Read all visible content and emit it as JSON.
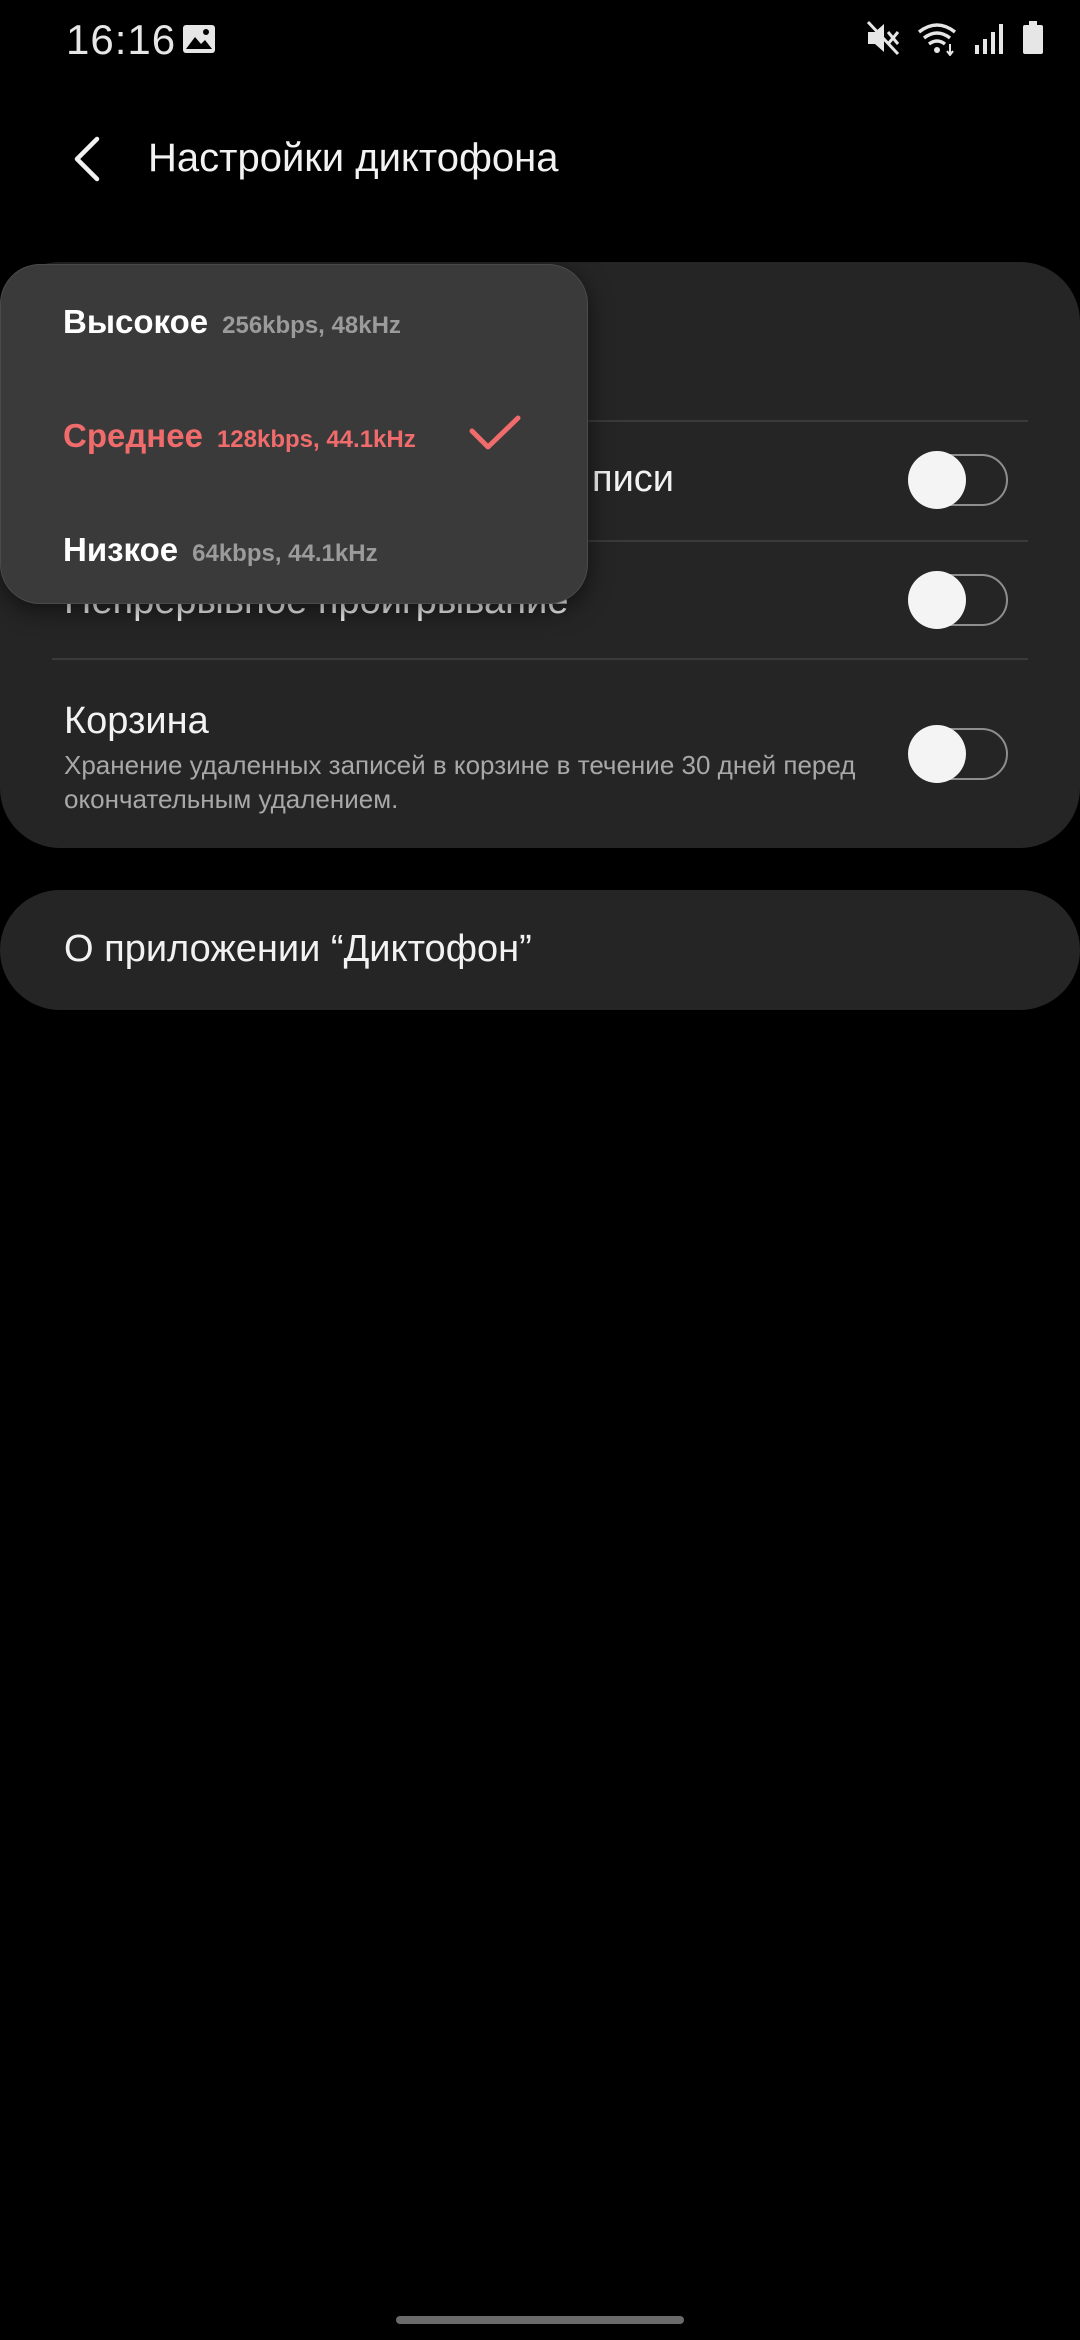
{
  "status_bar": {
    "time": "16:16",
    "icons": [
      "gallery-icon",
      "mute-icon",
      "wifi-icon",
      "signal-icon",
      "battery-icon"
    ]
  },
  "header": {
    "title": "Настройки диктофона",
    "back_icon": "chevron-left-icon"
  },
  "settings": {
    "row1_title_visible": "писи",
    "row2_title_visible": "Непрерывное проигрывание",
    "trash": {
      "title": "Корзина",
      "subtitle": "Хранение удаленных записей в корзине в течение 30 дней перед окончательным удалением."
    }
  },
  "about": {
    "label": "О приложении “Диктофон”"
  },
  "quality_menu": {
    "options": [
      {
        "name": "Высокое",
        "detail": "256kbps, 48kHz",
        "selected": false
      },
      {
        "name": "Среднее",
        "detail": "128kbps, 44.1kHz",
        "selected": true
      },
      {
        "name": "Низкое",
        "detail": "64kbps, 44.1kHz",
        "selected": false
      }
    ]
  },
  "colors": {
    "accent": "#f06b6b",
    "background": "#000000",
    "card": "#252525",
    "popup": "#3a3a3a"
  }
}
